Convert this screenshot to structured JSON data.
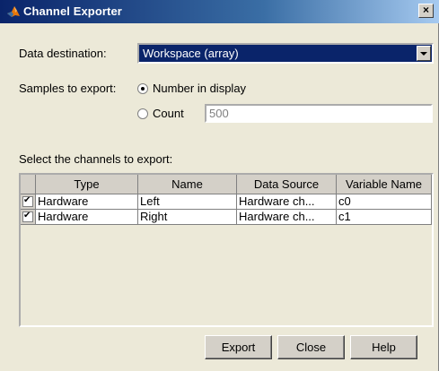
{
  "window": {
    "title": "Channel Exporter",
    "close_glyph": "×"
  },
  "destination": {
    "label": "Data destination:",
    "value": "Workspace (array)"
  },
  "samples": {
    "label": "Samples to export:",
    "options": [
      {
        "label": "Number in display",
        "selected": true
      },
      {
        "label": "Count",
        "selected": false
      }
    ],
    "count_value": "500"
  },
  "channels": {
    "label": "Select the channels to export:",
    "columns": [
      "Type",
      "Name",
      "Data Source",
      "Variable Name"
    ],
    "rows": [
      {
        "checked": true,
        "type": "Hardware",
        "name": "Left",
        "source": "Hardware ch...",
        "variable": "c0"
      },
      {
        "checked": true,
        "type": "Hardware",
        "name": "Right",
        "source": "Hardware ch...",
        "variable": "c1"
      }
    ]
  },
  "buttons": {
    "export": "Export",
    "close": "Close",
    "help": "Help"
  },
  "colors": {
    "title_bar": "#0a246a",
    "dialog_bg": "#ece9d8",
    "selected": "#0a246a"
  }
}
